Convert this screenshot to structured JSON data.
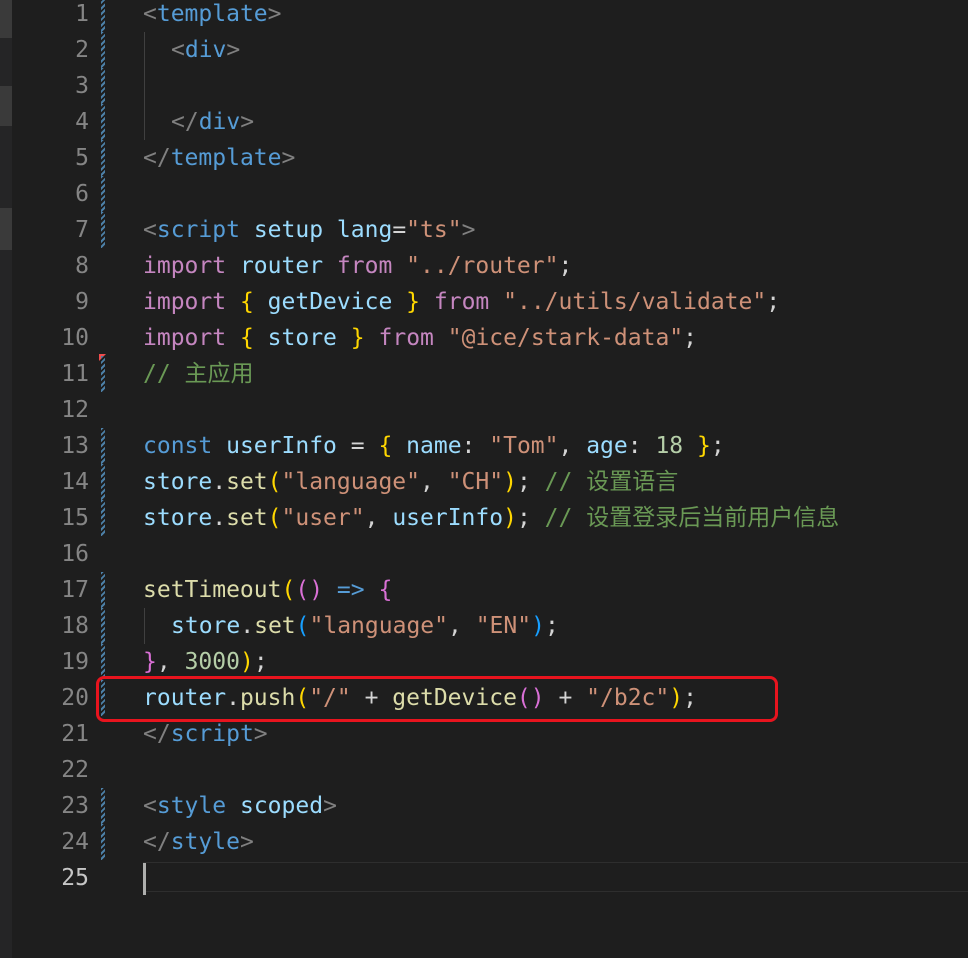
{
  "editor": {
    "language": "Vue SFC (TypeScript)",
    "active_line": 25,
    "lines": [
      {
        "no": "1"
      },
      {
        "no": "2"
      },
      {
        "no": "3"
      },
      {
        "no": "4"
      },
      {
        "no": "5"
      },
      {
        "no": "6"
      },
      {
        "no": "7"
      },
      {
        "no": "8"
      },
      {
        "no": "9"
      },
      {
        "no": "10"
      },
      {
        "no": "11"
      },
      {
        "no": "12"
      },
      {
        "no": "13"
      },
      {
        "no": "14"
      },
      {
        "no": "15"
      },
      {
        "no": "16"
      },
      {
        "no": "17"
      },
      {
        "no": "18"
      },
      {
        "no": "19"
      },
      {
        "no": "20"
      },
      {
        "no": "21"
      },
      {
        "no": "22"
      },
      {
        "no": "23"
      },
      {
        "no": "24"
      },
      {
        "no": "25"
      }
    ],
    "tokens": {
      "l1": [
        "<",
        "template",
        ">"
      ],
      "l2": [
        "<",
        "div",
        ">"
      ],
      "l4": [
        "</",
        "div",
        ">"
      ],
      "l5": [
        "</",
        "template",
        ">"
      ],
      "l7": [
        "<",
        "script",
        " ",
        "setup",
        " ",
        "lang",
        "=",
        "\"ts\"",
        ">"
      ],
      "l8": [
        "import",
        " ",
        "router",
        " ",
        "from",
        " ",
        "\"../router\"",
        ";"
      ],
      "l9": [
        "import",
        " ",
        "{",
        " ",
        "getDevice",
        " ",
        "}",
        " ",
        "from",
        " ",
        "\"../utils/validate\"",
        ";"
      ],
      "l10": [
        "import",
        " ",
        "{",
        " ",
        "store",
        " ",
        "}",
        " ",
        "from",
        " ",
        "\"@ice/stark-data\"",
        ";"
      ],
      "l11": [
        "// 主应用"
      ],
      "l13": [
        "const",
        " ",
        "userInfo",
        " = ",
        "{",
        " ",
        "name",
        ": ",
        "\"Tom\"",
        ", ",
        "age",
        ": ",
        "18",
        " ",
        "}",
        ";"
      ],
      "l14": [
        "store",
        ".",
        "set",
        "(",
        "\"language\"",
        ", ",
        "\"CH\"",
        ")",
        "; ",
        "// 设置语言"
      ],
      "l15": [
        "store",
        ".",
        "set",
        "(",
        "\"user\"",
        ", ",
        "userInfo",
        ")",
        "; ",
        "// 设置登录后当前用户信息"
      ],
      "l17": [
        "setTimeout",
        "(",
        "()",
        " => ",
        "{"
      ],
      "l18": [
        "store",
        ".",
        "set",
        "(",
        "\"language\"",
        ", ",
        "\"EN\"",
        ")",
        ";"
      ],
      "l19": [
        "}",
        ", ",
        "3000",
        ")",
        ";"
      ],
      "l20": [
        "router",
        ".",
        "push",
        "(",
        "\"/\"",
        " + ",
        "getDevice",
        "()",
        " + ",
        "\"/b2c\"",
        ")",
        ";"
      ],
      "l21": [
        "</",
        "script",
        ">"
      ],
      "l23": [
        "<",
        "style",
        " ",
        "scoped",
        ">"
      ],
      "l24": [
        "</",
        "style",
        ">"
      ]
    },
    "annotation": {
      "color": "#e8141e",
      "target_line": 20
    },
    "colors": {
      "background": "#1e1e1e",
      "tag_bracket": "#808080",
      "tag_name": "#569cd6",
      "attribute": "#9cdcfe",
      "string": "#ce9178",
      "keyword_import": "#c586c0",
      "keyword_storage": "#569cd6",
      "variable": "#9cdcfe",
      "function": "#dcdcaa",
      "number": "#b5cea8",
      "comment": "#6a9955",
      "bracket_level1": "#ffd700",
      "bracket_level2": "#da70d6",
      "bracket_level3": "#179fff"
    }
  }
}
